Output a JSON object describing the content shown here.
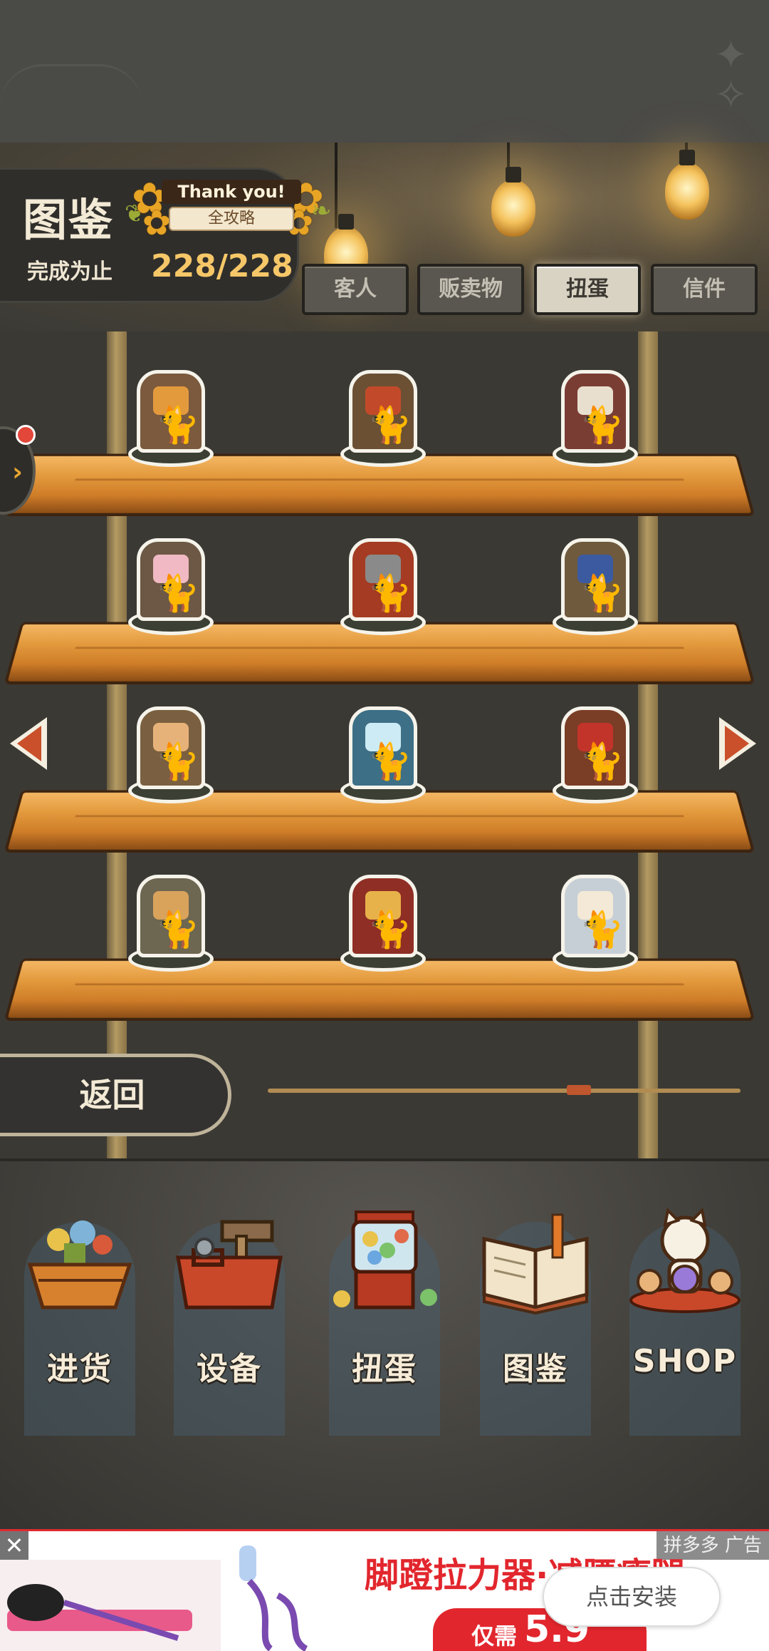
{
  "header": {
    "title": "图鉴",
    "badge_top": "Thank you!",
    "badge_sub": "全攻略",
    "progress_label": "完成为止",
    "progress_value": "228/228"
  },
  "tabs": [
    {
      "label": "客人",
      "active": false
    },
    {
      "label": "贩卖物",
      "active": false
    },
    {
      "label": "扭蛋",
      "active": true
    },
    {
      "label": "信件",
      "active": false
    }
  ],
  "shelf_items": [
    {
      "name": "cat-with-pot-figure",
      "figure": "#7b5a3d",
      "accent": "#e39a3d"
    },
    {
      "name": "cat-at-door-figure",
      "figure": "#6b5034",
      "accent": "#c24a2a"
    },
    {
      "name": "cat-on-tv-figure",
      "figure": "#7a3d34",
      "accent": "#e9dfcf"
    },
    {
      "name": "cat-with-flowers-figure",
      "figure": "#6c5844",
      "accent": "#f0b9c3"
    },
    {
      "name": "cat-on-postbox-figure",
      "figure": "#a43b22",
      "accent": "#8a8a8a"
    },
    {
      "name": "cat-on-shelf-figure",
      "figure": "#6f5a3e",
      "accent": "#3c5aa0"
    },
    {
      "name": "cat-at-table-figure",
      "figure": "#7a6040",
      "accent": "#e7b27a"
    },
    {
      "name": "cat-with-lamp-figure",
      "figure": "#3d6f86",
      "accent": "#cdebf4"
    },
    {
      "name": "cat-in-phonebooth-figure",
      "figure": "#7a3d26",
      "accent": "#c2342a"
    },
    {
      "name": "cat-on-bucket-figure",
      "figure": "#6d6650",
      "accent": "#d9a35c"
    },
    {
      "name": "cat-under-kotatsu-figure",
      "figure": "#8f2e25",
      "accent": "#e8b24a"
    },
    {
      "name": "cat-in-snow-figure",
      "figure": "#c7cfd6",
      "accent": "#f3e9d6"
    }
  ],
  "back_button": "返回",
  "nav": [
    {
      "label": "进货",
      "icon": "restock-icon"
    },
    {
      "label": "设备",
      "icon": "toolbox-icon"
    },
    {
      "label": "扭蛋",
      "icon": "gacha-machine-icon"
    },
    {
      "label": "图鉴",
      "icon": "open-book-icon"
    },
    {
      "label": "SHOP",
      "icon": "lucky-cat-icon"
    }
  ],
  "ad": {
    "headline": "脚蹬拉力器·减腰瘦腿",
    "install": "点击安装",
    "price_prefix": "仅需",
    "price_value": "5.9",
    "tag": "拼多多 广告",
    "close": "✕"
  }
}
